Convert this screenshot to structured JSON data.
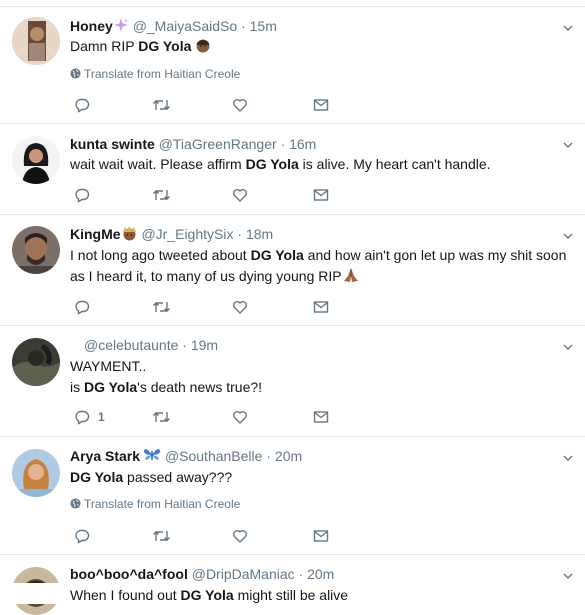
{
  "tweets": [
    {
      "name": "Honey",
      "handle": "@_MaiyaSaidSo",
      "dot": "·",
      "time": "15m",
      "text_pre": "Damn RIP ",
      "text_bold": "DG Yola",
      "text_post": "",
      "translate": "Translate from Haitian Creole",
      "reply_count": ""
    },
    {
      "name": "kunta swinte",
      "handle": "@TiaGreenRanger",
      "dot": "·",
      "time": "16m",
      "text_pre": "wait wait wait. Please affirm ",
      "text_bold": "DG Yola",
      "text_post": " is alive. My heart can't handle.",
      "reply_count": ""
    },
    {
      "name": "KingMe",
      "handle": "@Jr_EightySix",
      "dot": "·",
      "time": "18m",
      "text_pre": "I not long ago tweeted about ",
      "text_bold": "DG Yola",
      "text_post": " and how ain't gon let up was my shit soon as I heard it, to many of us dying young RIP",
      "reply_count": ""
    },
    {
      "name": "",
      "handle": "@celebutaunte",
      "dot": "·",
      "time": "19m",
      "line1": "WAYMENT..",
      "text_pre": "is ",
      "text_bold": "DG Yola",
      "text_post": "'s death news true?!",
      "reply_count": "1"
    },
    {
      "name": "Arya Stark",
      "handle": "@SouthanBelle",
      "dot": "·",
      "time": "20m",
      "text_pre": "",
      "text_bold": "DG Yola",
      "text_post": " passed away???",
      "translate": "Translate from Haitian Creole",
      "reply_count": ""
    },
    {
      "name": "boo^boo^da^fool",
      "handle": "@DripDaManiac",
      "dot": "·",
      "time": "20m",
      "text_pre": "When I found out ",
      "text_bold": "DG Yola",
      "text_post": " might still be alive"
    }
  ]
}
